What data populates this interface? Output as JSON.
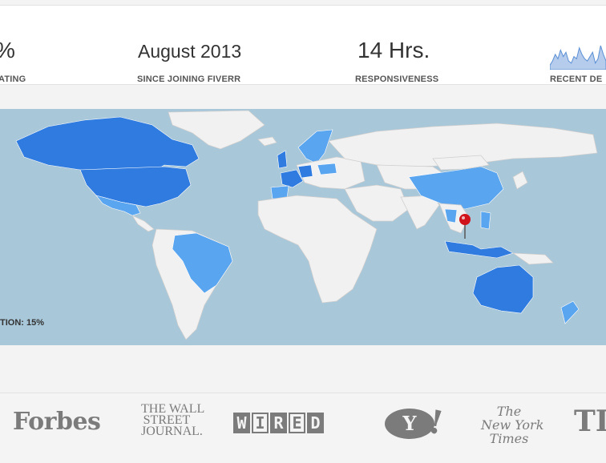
{
  "stats": [
    {
      "value": "%",
      "label": "ATING"
    },
    {
      "value": "August 2013",
      "label": "SINCE JOINING FIVERR"
    },
    {
      "value": "14 Hrs.",
      "label": "RESPONSIVENESS"
    },
    {
      "value": "",
      "label": "RECENT DE"
    }
  ],
  "sparkline": {
    "values": [
      2,
      4,
      7,
      5,
      9,
      6,
      8,
      4,
      3,
      6,
      5,
      10,
      7,
      5,
      4,
      6,
      8,
      3,
      5,
      11,
      7,
      4
    ],
    "color": "#5b8fd4"
  },
  "map": {
    "caption": "TION: 15%",
    "ocean_color": "#a8c7d9",
    "land_color": "#f1f1f1",
    "dark_color": "#2f7be0",
    "light_color": "#5aa5ef",
    "marker_color": "#d0121a"
  },
  "press": {
    "forbes": "Forbes",
    "wsj": [
      "THE WALL",
      "STREET",
      "JOURNAL."
    ],
    "wired": [
      "W",
      "I",
      "R",
      "E",
      "D"
    ],
    "yahoo_y": "Y",
    "yahoo_bang": "!",
    "nyt": [
      "The",
      "New York",
      "Times"
    ],
    "time": "TI"
  }
}
